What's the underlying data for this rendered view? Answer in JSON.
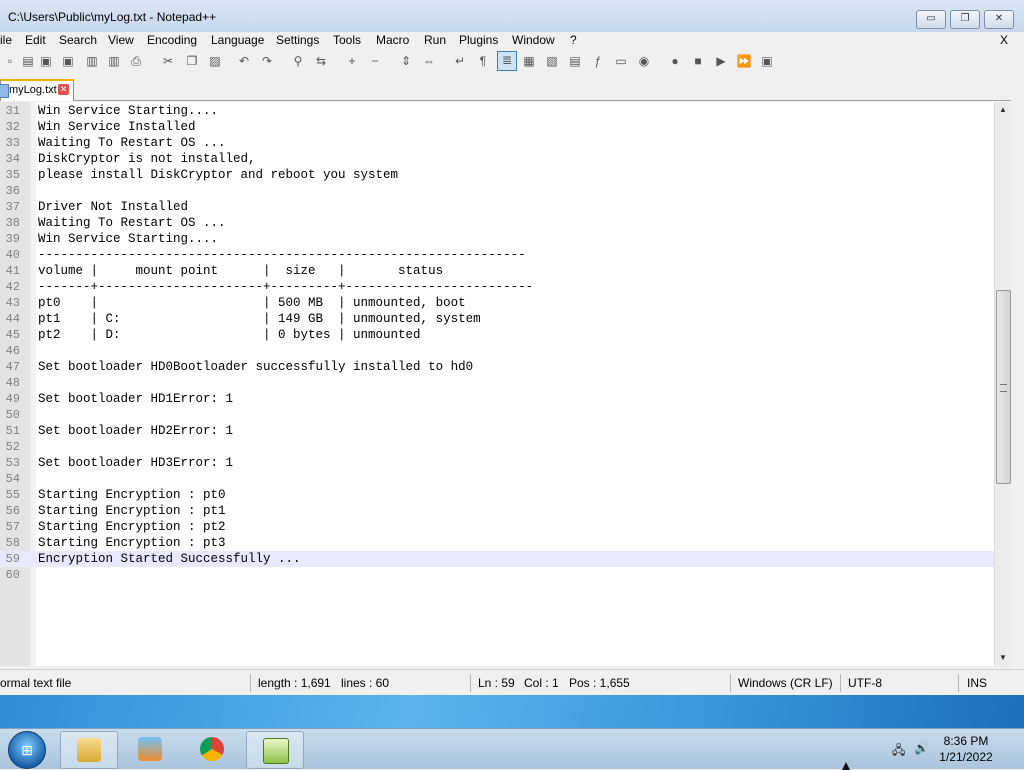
{
  "window": {
    "title": "C:\\Users\\Public\\myLog.txt - Notepad++",
    "minimize": "▭",
    "maximize": "❐",
    "close": "✕"
  },
  "menu": {
    "items": [
      "ile",
      "Edit",
      "Search",
      "View",
      "Encoding",
      "Language",
      "Settings",
      "Tools",
      "Macro",
      "Run",
      "Plugins",
      "Window",
      "?"
    ],
    "close_doc": "X"
  },
  "tab": {
    "label": "myLog.txt",
    "close": "✕"
  },
  "editor": {
    "current_line": 59,
    "lines": [
      {
        "n": "31",
        "text": "Win Service Starting...."
      },
      {
        "n": "32",
        "text": "Win Service Installed"
      },
      {
        "n": "33",
        "text": "Waiting To Restart OS ..."
      },
      {
        "n": "34",
        "text": "DiskCryptor is not installed,"
      },
      {
        "n": "35",
        "text": "please install DiskCryptor and reboot you system"
      },
      {
        "n": "36",
        "text": ""
      },
      {
        "n": "37",
        "text": "Driver Not Installed"
      },
      {
        "n": "38",
        "text": "Waiting To Restart OS ..."
      },
      {
        "n": "39",
        "text": "Win Service Starting...."
      },
      {
        "n": "40",
        "text": "-----------------------------------------------------------------"
      },
      {
        "n": "41",
        "text": "volume |     mount point      |  size   |       status"
      },
      {
        "n": "42",
        "text": "-------+----------------------+---------+-------------------------"
      },
      {
        "n": "43",
        "text": "pt0    |                      | 500 MB  | unmounted, boot"
      },
      {
        "n": "44",
        "text": "pt1    | C:                   | 149 GB  | unmounted, system"
      },
      {
        "n": "45",
        "text": "pt2    | D:                   | 0 bytes | unmounted"
      },
      {
        "n": "46",
        "text": ""
      },
      {
        "n": "47",
        "text": "Set bootloader HD0Bootloader successfully installed to hd0"
      },
      {
        "n": "48",
        "text": ""
      },
      {
        "n": "49",
        "text": "Set bootloader HD1Error: 1"
      },
      {
        "n": "50",
        "text": ""
      },
      {
        "n": "51",
        "text": "Set bootloader HD2Error: 1"
      },
      {
        "n": "52",
        "text": ""
      },
      {
        "n": "53",
        "text": "Set bootloader HD3Error: 1"
      },
      {
        "n": "54",
        "text": ""
      },
      {
        "n": "55",
        "text": "Starting Encryption : pt0"
      },
      {
        "n": "56",
        "text": "Starting Encryption : pt1"
      },
      {
        "n": "57",
        "text": "Starting Encryption : pt2"
      },
      {
        "n": "58",
        "text": "Starting Encryption : pt3"
      },
      {
        "n": "59",
        "text": "Encryption Started Successfully ..."
      },
      {
        "n": "60",
        "text": ""
      }
    ]
  },
  "status": {
    "file_type": "ormal text file",
    "length": "length : 1,691",
    "lines": "lines : 60",
    "ln": "Ln : 59",
    "col": "Col : 1",
    "pos": "Pos : 1,655",
    "eol": "Windows (CR LF)",
    "encoding": "UTF-8",
    "mode": "INS"
  },
  "taskbar": {
    "time": "8:36 PM",
    "date": "1/21/2022"
  },
  "colors": {
    "current_line": "#e8e8ff",
    "tab_accent": "#fab000",
    "gutter": "#e4e4e4"
  }
}
